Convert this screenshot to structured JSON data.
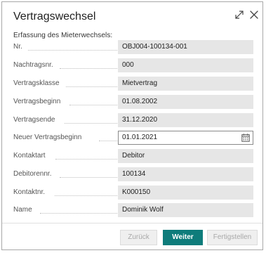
{
  "dialog": {
    "title": "Vertragswechsel",
    "header_icons": [
      "expand-icon",
      "close-icon"
    ]
  },
  "section": {
    "title": "Erfassung des Mieterwechsels:"
  },
  "fields": [
    {
      "label": "Nr.",
      "value": "OBJ004-100134-001"
    },
    {
      "label": "Nachtragsnr.",
      "value": "000"
    },
    {
      "label": "Vertragsklasse",
      "value": "Mietvertrag"
    },
    {
      "label": "Vertragsbeginn",
      "value": "01.08.2002"
    },
    {
      "label": "Vertragsende",
      "value": "31.12.2020"
    },
    {
      "label": "Neuer Vertragsbeginn",
      "value": "01.01.2021",
      "editable": true,
      "icon": "calendar-icon"
    },
    {
      "label": "Kontaktart",
      "value": "Debitor"
    },
    {
      "label": "Debitorennr.",
      "value": "100134"
    },
    {
      "label": "Kontaktnr.",
      "value": "K000150"
    },
    {
      "label": "Name",
      "value": "Dominik Wolf"
    }
  ],
  "buttons": {
    "back": {
      "label": "Zurück",
      "enabled": false
    },
    "next": {
      "label": "Weiter",
      "enabled": true
    },
    "finish": {
      "label": "Fertigstellen",
      "enabled": false
    }
  },
  "colors": {
    "primary": "#0e7c7b",
    "field_background": "#e6e6e6",
    "disabled_text": "#a8a8a8"
  }
}
